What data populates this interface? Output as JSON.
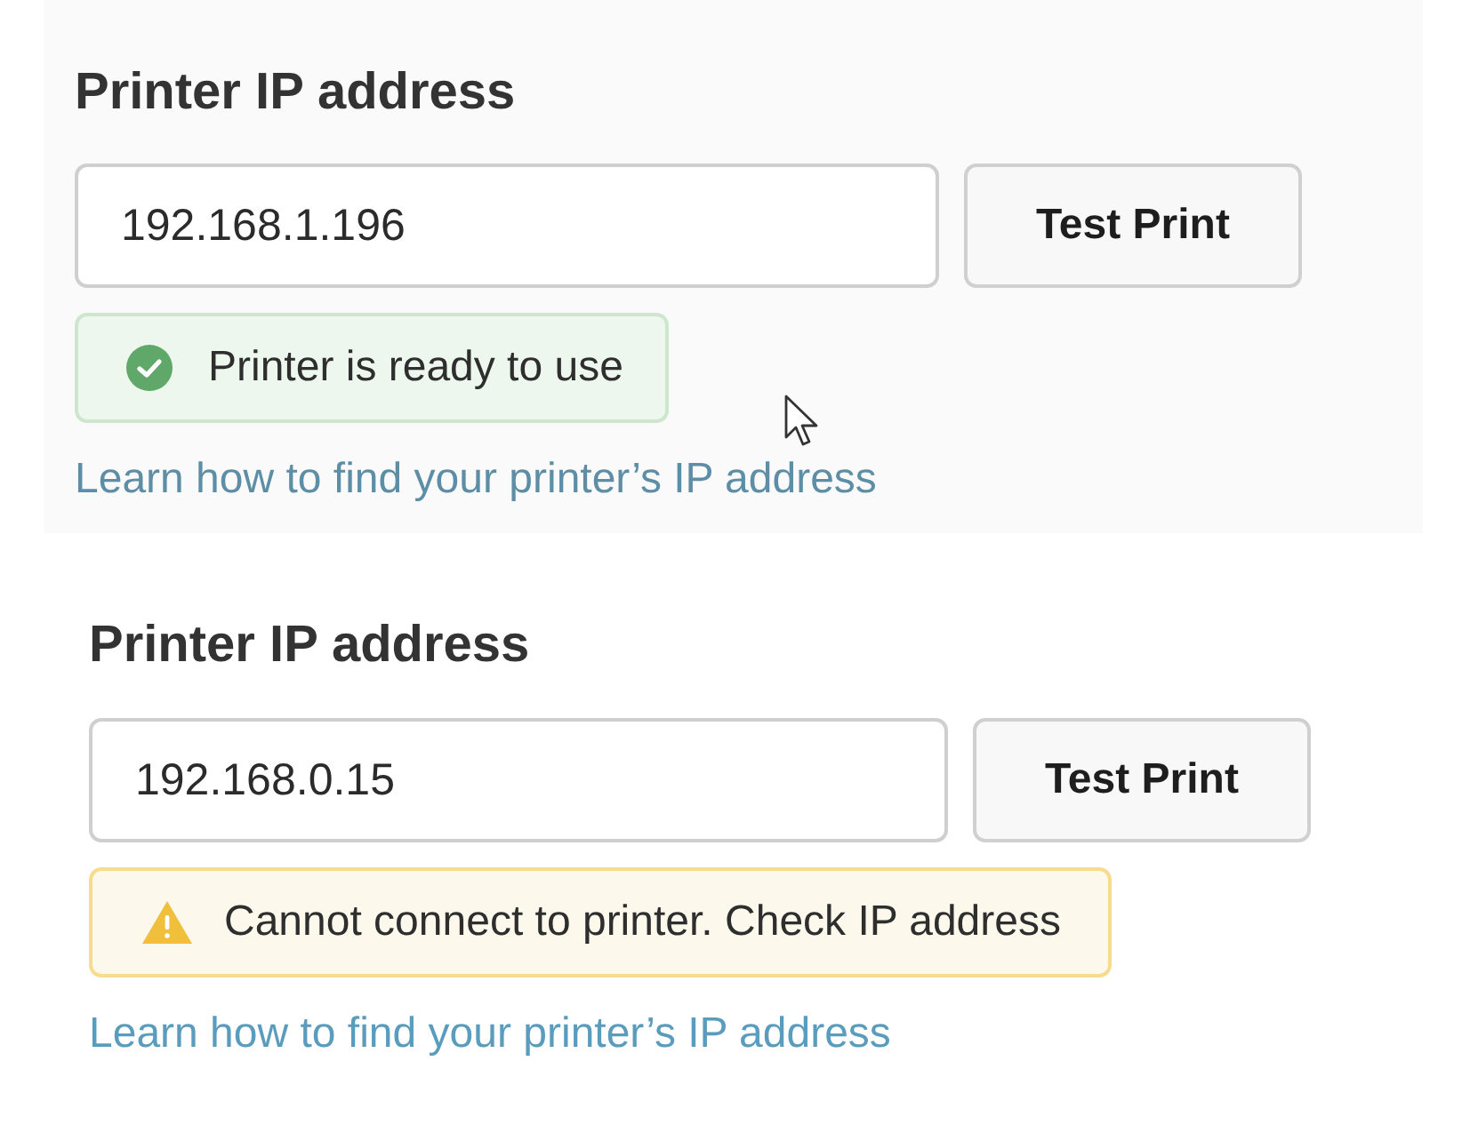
{
  "panels": [
    {
      "label": "Printer IP address",
      "ip_value": "192.168.1.196",
      "button": "Test Print",
      "status": {
        "kind": "success",
        "text": "Printer is ready to use"
      },
      "link": "Learn how to find your printer’s IP address"
    },
    {
      "label": "Printer IP address",
      "ip_value": "192.168.0.15",
      "button": "Test Print",
      "status": {
        "kind": "warning",
        "text": "Cannot connect to printer. Check IP address"
      },
      "link": "Learn how to find your printer’s IP address"
    }
  ]
}
